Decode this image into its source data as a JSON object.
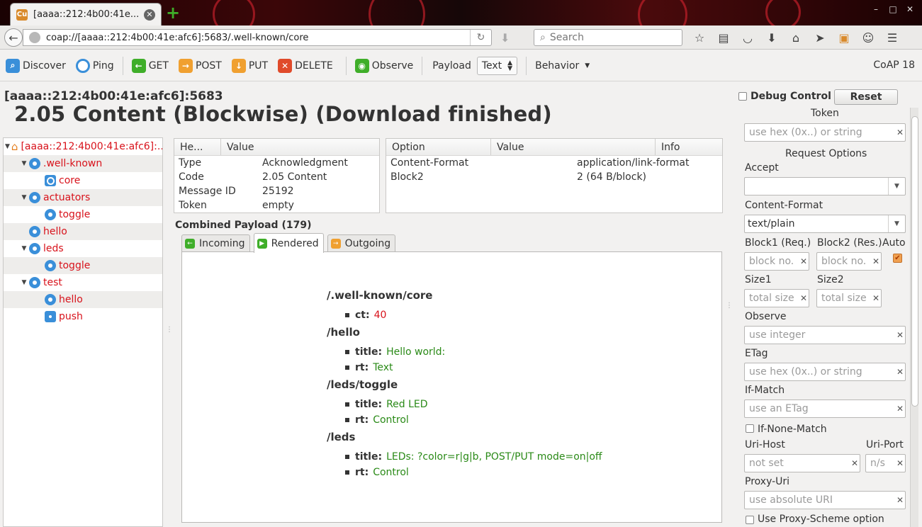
{
  "browser": {
    "tab_title": "[aaaa::212:4b00:41e...",
    "url": "coap://[aaaa::212:4b00:41e:afc6]:5683/.well-known/core",
    "search_placeholder": "Search"
  },
  "toolbar": {
    "discover": "Discover",
    "ping": "Ping",
    "get": "GET",
    "post": "POST",
    "put": "PUT",
    "delete": "DELETE",
    "observe": "Observe",
    "payload_label": "Payload",
    "payload_format": "Text",
    "behavior": "Behavior",
    "version": "CoAP 18"
  },
  "header": {
    "address": "[aaaa::212:4b00:41e:afc6]:5683",
    "status": "2.05 Content (Blockwise) (Download finished)"
  },
  "tree": [
    {
      "label": "[aaaa::212:4b00:41e:afc6]:...",
      "icon": "home-icon",
      "twisty": "▼",
      "indent": 0
    },
    {
      "label": ".well-known",
      "icon": "globe-icon",
      "twisty": "▼",
      "indent": 1
    },
    {
      "label": "core",
      "icon": "query-icon",
      "twisty": "",
      "indent": 2
    },
    {
      "label": "actuators",
      "icon": "resource-icon",
      "twisty": "▼",
      "indent": 1
    },
    {
      "label": "toggle",
      "icon": "resource-icon",
      "twisty": "",
      "indent": 2
    },
    {
      "label": "hello",
      "icon": "resource-icon",
      "twisty": "",
      "indent": 1
    },
    {
      "label": "leds",
      "icon": "resource-icon",
      "twisty": "▼",
      "indent": 1
    },
    {
      "label": "toggle",
      "icon": "resource-icon",
      "twisty": "",
      "indent": 2
    },
    {
      "label": "test",
      "icon": "resource-icon",
      "twisty": "▼",
      "indent": 1
    },
    {
      "label": "hello",
      "icon": "resource-icon",
      "twisty": "",
      "indent": 2
    },
    {
      "label": "push",
      "icon": "rss-icon",
      "twisty": "",
      "indent": 2
    }
  ],
  "headers_table": {
    "columns": [
      "He...",
      "Value"
    ],
    "rows": [
      [
        "Type",
        "Acknowledgment"
      ],
      [
        "Code",
        "2.05 Content"
      ],
      [
        "Message ID",
        "25192"
      ],
      [
        "Token",
        "empty"
      ]
    ]
  },
  "options_table": {
    "columns": [
      "Option",
      "Value",
      "Info"
    ],
    "rows": [
      [
        "Content-Format",
        "application/link-format",
        ""
      ],
      [
        "Block2",
        "2 (64 B/block)",
        ""
      ]
    ]
  },
  "payload": {
    "label": "Combined Payload (179)",
    "tabs": [
      "Incoming",
      "Rendered",
      "Outgoing"
    ],
    "active_tab": "Rendered",
    "resources": [
      {
        "path": "/.well-known/core",
        "attrs": [
          {
            "k": "ct:",
            "v": "40",
            "kind": "num"
          }
        ]
      },
      {
        "path": "/hello",
        "attrs": [
          {
            "k": "title:",
            "v": "Hello world:",
            "kind": "str"
          },
          {
            "k": "rt:",
            "v": "Text",
            "kind": "str"
          }
        ]
      },
      {
        "path": "/leds/toggle",
        "attrs": [
          {
            "k": "title:",
            "v": "Red LED",
            "kind": "str"
          },
          {
            "k": "rt:",
            "v": "Control",
            "kind": "str"
          }
        ]
      },
      {
        "path": "/leds",
        "attrs": [
          {
            "k": "title:",
            "v": "LEDs: ?color=r|g|b, POST/PUT mode=on|off",
            "kind": "str"
          },
          {
            "k": "rt:",
            "v": "Control",
            "kind": "str"
          }
        ]
      }
    ]
  },
  "sidebar": {
    "debug_control": "Debug Control",
    "reset": "Reset",
    "token_heading": "Token",
    "token_placeholder": "use hex (0x..) or string",
    "request_options": "Request Options",
    "accept": "Accept",
    "accept_value": "",
    "content_format": "Content-Format",
    "content_format_value": "text/plain",
    "block1": "Block1 (Req.)",
    "block2": "Block2 (Res.)",
    "auto": "Auto",
    "auto_checked": true,
    "block_placeholder": "block no.",
    "size1": "Size1",
    "size2": "Size2",
    "size_placeholder": "total size",
    "observe": "Observe",
    "observe_placeholder": "use integer",
    "etag": "ETag",
    "etag_placeholder": "use hex (0x..) or string",
    "if_match": "If-Match",
    "if_match_placeholder": "use an ETag",
    "if_none_match": "If-None-Match",
    "uri_host": "Uri-Host",
    "uri_host_placeholder": "not set",
    "uri_port": "Uri-Port",
    "uri_port_placeholder": "n/s",
    "proxy_uri": "Proxy-Uri",
    "proxy_uri_placeholder": "use absolute URI",
    "use_proxy_scheme": "Use Proxy-Scheme option"
  },
  "colors": {
    "accent_red": "#d8121b",
    "value_green": "#2a8a17",
    "tree_icon_blue": "#3a8fd9"
  }
}
